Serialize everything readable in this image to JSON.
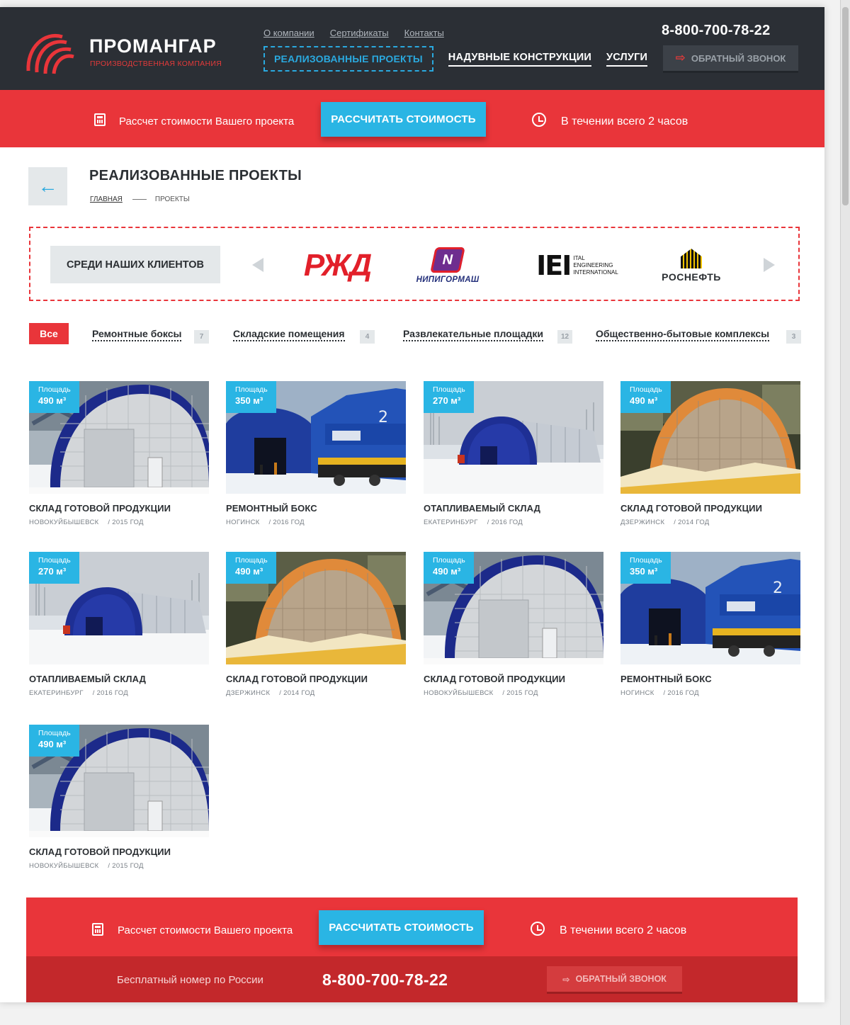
{
  "header": {
    "brand": "ПРОМАНГАР",
    "brand_sub": "ПРОИЗВОДСТВЕННАЯ КОМПАНИЯ",
    "top_links": [
      "О компании",
      "Сертификаты",
      "Контакты"
    ],
    "nav_active": "РЕАЛИЗОВАННЫЕ ПРОЕКТЫ",
    "nav_items": [
      "НАДУВНЫЕ КОНСТРУКЦИИ",
      "УСЛУГИ"
    ],
    "phone": "8-800-700-78-22",
    "callback": "ОБРАТНЫЙ ЗВОНОК"
  },
  "promo": {
    "text_left": "Рассчет стоимости Вашего проекта",
    "cta": "РАССЧИТАТЬ СТОИМОСТЬ",
    "text_right": "В течении всего 2 часов"
  },
  "page": {
    "title": "РЕАЛИЗОВАННЫЕ ПРОЕКТЫ",
    "breadcrumb_home": "ГЛАВНАЯ",
    "breadcrumb_current": "ПРОЕКТЫ"
  },
  "clients": {
    "label": "СРЕДИ НАШИХ КЛИЕНТОВ",
    "logos": [
      "РЖД",
      "НИПИГОРМАШ",
      "IEI ITAL ENGINEERING INTERNATIONAL",
      "РОСНЕФТЬ"
    ],
    "rzd_text": "РЖД",
    "nipi_mark": "N",
    "nipi_text": "НИПИГОРМАШ",
    "iei_big": "IEI",
    "iei_small": [
      "ITAL",
      "ENGINEERING",
      "INTERNATIONAL"
    ],
    "rosn_text": "РОСНЕФТЬ"
  },
  "filters": {
    "all": "Все",
    "items": [
      {
        "label": "Ремонтные боксы",
        "count": "7"
      },
      {
        "label": "Складские помещения",
        "count": "4"
      },
      {
        "label": "Развлекательные площадки",
        "count": "12"
      },
      {
        "label": "Общественно-бытовые комплексы",
        "count": "3"
      }
    ]
  },
  "area_label": "Площадь",
  "projects": [
    {
      "area": "490 м³",
      "title": "СКЛАД ГОТОВОЙ ПРОДУКЦИИ",
      "city": "НОВОКУЙБЫШЕВСК",
      "year": "/ 2015 ГОД",
      "photo": "grey-hangar"
    },
    {
      "area": "350 м³",
      "title": "РЕМОНТНЫЙ БОКС",
      "city": "НОГИНСК",
      "year": "/ 2016 ГОД",
      "photo": "blue-train"
    },
    {
      "area": "270 м³",
      "title": "ОТАПЛИВАЕМЫЙ СКЛАД",
      "city": "ЕКАТЕРИНБУРГ",
      "year": "/ 2016 ГОД",
      "photo": "long-tunnel"
    },
    {
      "area": "490 м³",
      "title": "СКЛАД ГОТОВОЙ ПРОДУКЦИИ",
      "city": "ДЗЕРЖИНСК",
      "year": "/ 2014 ГОД",
      "photo": "lit-hangar"
    },
    {
      "area": "270 м³",
      "title": "ОТАПЛИВАЕМЫЙ СКЛАД",
      "city": "ЕКАТЕРИНБУРГ",
      "year": "/ 2016 ГОД",
      "photo": "long-tunnel"
    },
    {
      "area": "490 м³",
      "title": "СКЛАД ГОТОВОЙ ПРОДУКЦИИ",
      "city": "ДЗЕРЖИНСК",
      "year": "/ 2014 ГОД",
      "photo": "lit-hangar"
    },
    {
      "area": "490 м³",
      "title": "СКЛАД ГОТОВОЙ ПРОДУКЦИИ",
      "city": "НОВОКУЙБЫШЕВСК",
      "year": "/ 2015 ГОД",
      "photo": "grey-hangar"
    },
    {
      "area": "350 м³",
      "title": "РЕМОНТНЫЙ БОКС",
      "city": "НОГИНСК",
      "year": "/ 2016 ГОД",
      "photo": "blue-train"
    },
    {
      "area": "490 м³",
      "title": "СКЛАД ГОТОВОЙ ПРОДУКЦИИ",
      "city": "НОВОКУЙБЫШЕВСК",
      "year": "/ 2015 ГОД",
      "photo": "grey-hangar"
    }
  ],
  "footer": {
    "free_text": "Бесплатный номер по России",
    "phone": "8-800-700-78-22",
    "callback": "ОБРАТНЫЙ ЗВОНОК"
  },
  "colors": {
    "accent_red": "#e9353a",
    "accent_blue": "#2ab5e4",
    "header_dark": "#2b2f35"
  }
}
